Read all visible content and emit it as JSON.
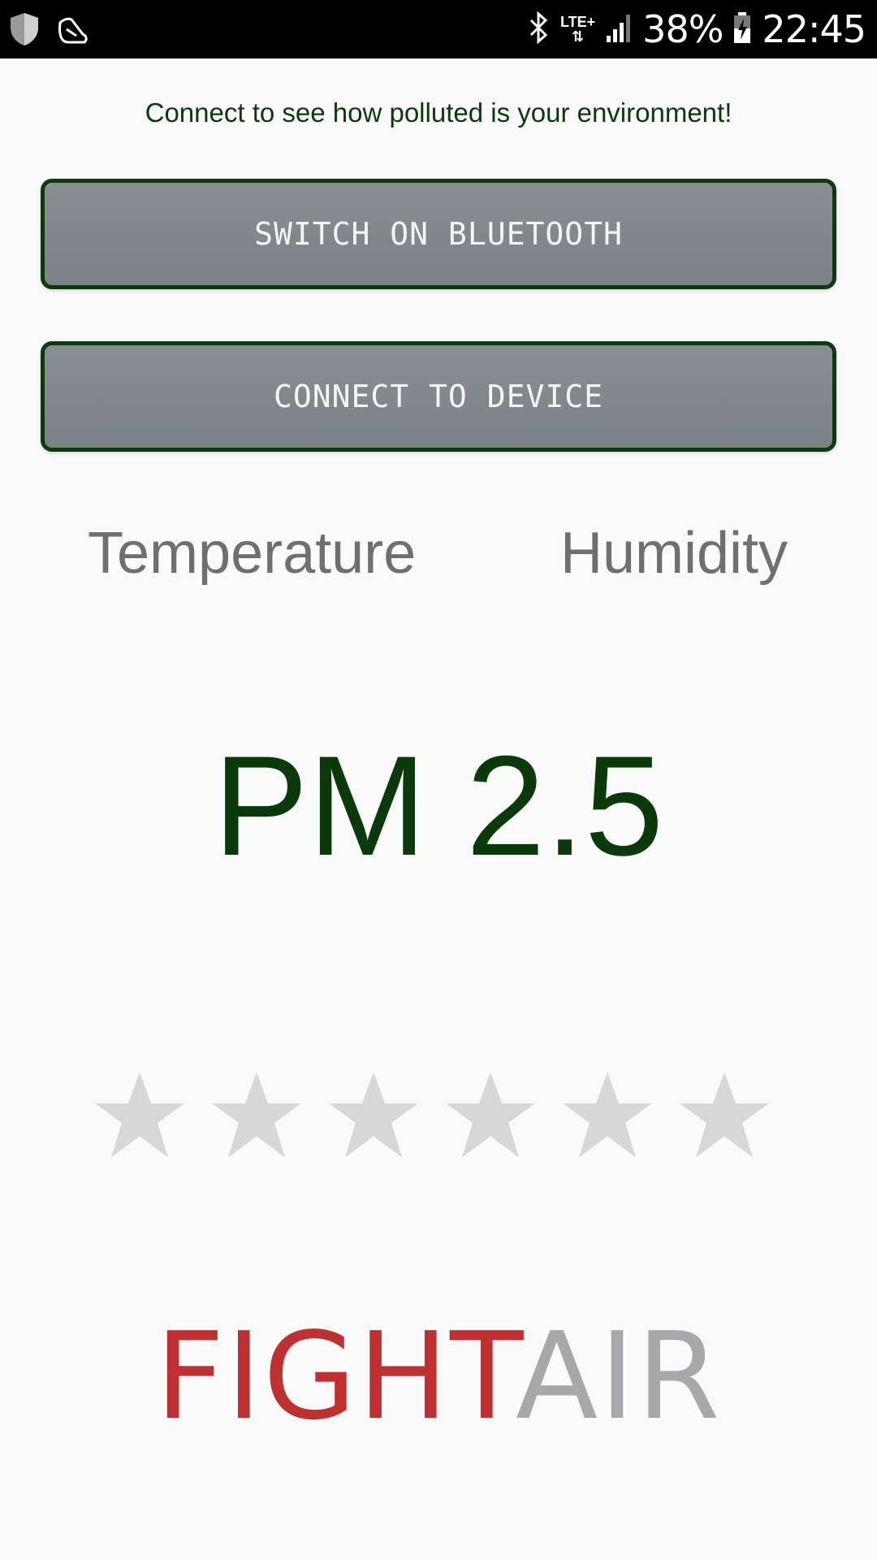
{
  "status_bar": {
    "battery": "38%",
    "time": "22:45",
    "network": "LTE+",
    "icons": [
      "shield-icon",
      "shoe-icon",
      "bluetooth-icon",
      "signal-icon",
      "battery-charging-icon"
    ]
  },
  "subtitle": "Connect to see how polluted is your environment!",
  "buttons": {
    "bluetooth": "SWITCH ON BLUETOOTH",
    "connect": "CONNECT TO DEVICE"
  },
  "metrics": {
    "temperature": "Temperature",
    "humidity": "Humidity"
  },
  "pm_label": "PM 2.5",
  "rating": {
    "total_stars": 6,
    "filled_stars": 0,
    "star_color": "#d7d7d7"
  },
  "logo": {
    "part1": "FIGHT",
    "part2": "AIR",
    "color1": "#bf3030",
    "color2": "#a8a8ab"
  },
  "colors": {
    "accent_green": "#0a3a0a",
    "button_gray": "#82878c"
  }
}
